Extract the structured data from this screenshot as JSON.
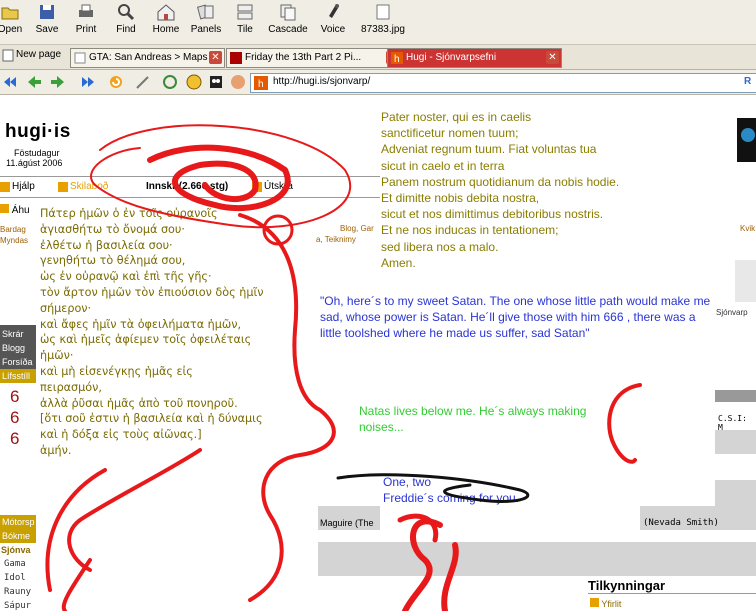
{
  "toolbar": {
    "buttons": [
      {
        "label": "Open",
        "icon": "folder-icon"
      },
      {
        "label": "Save",
        "icon": "save-icon"
      },
      {
        "label": "Print",
        "icon": "print-icon"
      },
      {
        "label": "Find",
        "icon": "find-icon"
      },
      {
        "label": "Home",
        "icon": "home-icon"
      },
      {
        "label": "Panels",
        "icon": "panels-icon"
      },
      {
        "label": "Tile",
        "icon": "tile-icon"
      },
      {
        "label": "Cascade",
        "icon": "cascade-icon"
      },
      {
        "label": "Voice",
        "icon": "voice-icon"
      },
      {
        "label": "87383.jpg",
        "icon": "image-icon"
      }
    ]
  },
  "tabs": {
    "new_page": "New page",
    "items": [
      {
        "title": "GTA: San Andreas > Maps",
        "active": false
      },
      {
        "title": "Friday the 13th Part 2 Pi...",
        "active": false
      },
      {
        "title": "Hugi - Sjónvarpsefni",
        "active": true
      }
    ]
  },
  "address": {
    "url": "http://hugi.is/sjonvarp/",
    "right_label": "R"
  },
  "site": {
    "logo": "hugi·is",
    "day": "Föstudagur",
    "date": "11.ágúst 2006",
    "nav": [
      "Hjálp",
      "Skilaboð",
      "Innskr (2.666 stg)",
      "Útskrá"
    ],
    "cat_label": "Áhu",
    "subnav_left": [
      "Bardag",
      "Myndas"
    ],
    "subnav_right": [
      "a, Teiknimy"
    ],
    "subnav_right2": [
      "Blog, Gar"
    ],
    "right_kvik": "Kvik",
    "right_sjonvarp": "Sjónvarp",
    "csi": "C.S.I: M",
    "sidebar": [
      "Skrár",
      "Blogg",
      "Forsíða",
      "Lífsstíll"
    ],
    "sidebar_bottom": [
      "Mótorsp",
      "Bókme",
      "Sjónva"
    ],
    "sidebar_links": [
      "Gama",
      "Idol",
      "Rauny",
      "Sápur"
    ],
    "row_left": "Maguire (The",
    "row_right": "(Nevada Smith)",
    "tilk": "Tilkynningar",
    "yfirlit": "Yfirlit"
  },
  "overlay": {
    "greek": [
      "Πάτερ ἡμῶν ὁ ἐν τοῖς οὐρανοῖς",
      "ἁγιασθήτω τὸ ὄνομά σου·",
      "ἐλθέτω ἡ βασιλεία σου·",
      "γενηθήτω τὸ θέλημά σου,",
      "ὡς ἐν οὐρανῷ καὶ ἐπὶ τῆς γῆς·",
      "τὸν ἄρτον ἡμῶν τὸν ἐπιούσιον δὸς ἡμῖν",
      "σήμερον·",
      "καὶ ἄφες ἡμῖν τὰ ὀφειλήματα ἡμῶν,",
      "ὡς καὶ ἡμεῖς ἀφίεμεν τοῖς ὀφειλέταις",
      "ἡμῶν·",
      "καὶ μὴ εἰσενέγκῃς ἡμᾶς εἰς",
      "πειρασμόν,",
      "ἀλλὰ ῥῦσαι ἡμᾶς ἀπὸ τοῦ πονηροῦ.",
      "[ὅτι σοῦ ἐστιν ἡ βασιλεία καὶ ἡ δύναμις",
      "καὶ ἡ δόξα εἰς τοὺς αἰῶνας.]",
      "ἀμήν."
    ],
    "latin": [
      "Pater noster, qui es in caelis",
      "sanctificetur nomen tuum;",
      "Adveniat regnum tuum. Fiat voluntas tua",
      "sicut in caelo et in terra",
      "Panem nostrum quotidianum da nobis hodie.",
      "Et dimitte nobis debita nostra,",
      "sicut et nos dimittimus debitoribus nostris.",
      "Et ne nos inducas in tentationem;",
      "sed libera nos a malo.",
      "Amen."
    ],
    "satan_quote": "\"Oh, here´s to my sweet Satan. The one whose little path would make me sad, whose power is Satan. He´ll give those with him 666 , there was a little toolshed where he made us suffer, sad Satan\"",
    "natas": "Natas lives below me. He´s always making noises...",
    "one_two": "One, two",
    "freddie": "Freddie´s coming for you.",
    "sixes": [
      "6",
      "6",
      "6"
    ]
  },
  "colors": {
    "scribble": "#e8191a",
    "greek_text": "#7a6a00",
    "latin_text": "#8a7d00",
    "blue_text": "#2a34d4",
    "green_text": "#33cc33"
  }
}
